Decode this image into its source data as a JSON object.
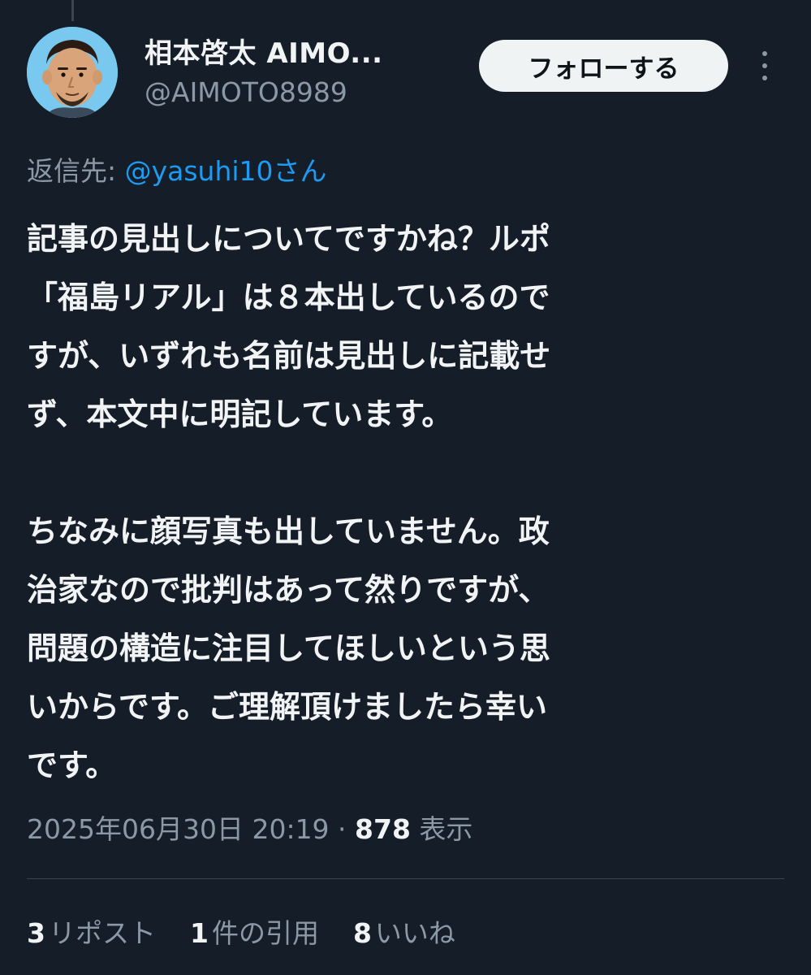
{
  "author": {
    "display_name": "相本啓太 AIMO...",
    "handle": "@AIMOTO8989"
  },
  "follow_label": "フォローする",
  "reply_to": {
    "prefix": "返信先: ",
    "mention": "@yasuhi10さん"
  },
  "tweet": {
    "paragraphs": [
      [
        "記事の見出しについてですかね？ルポ",
        "「福島リアル」は８本出しているので",
        "すが、いずれも名前は見出しに記載せ",
        "ず、本文中に明記しています。"
      ],
      [
        "ちなみに顔写真も出していません。政",
        "治家なので批判はあって然りですが、",
        "問題の構造に注目してほしいという思",
        "いからです。ご理解頂けましたら幸い",
        "です。"
      ]
    ]
  },
  "meta": {
    "timestamp": "2025年06月30日 20:19 · ",
    "views_count": "878",
    "views_label": " 表示"
  },
  "stats": {
    "reposts": {
      "count": "3",
      "label": "リポスト"
    },
    "quotes": {
      "count": "1",
      "label": "件の引用"
    },
    "likes": {
      "count": "8",
      "label": "いいね"
    }
  },
  "colors": {
    "background": "#151d28",
    "text_primary": "#f1f3f4",
    "text_secondary": "#8b98a5",
    "link": "#1d9bf0",
    "follow_button_bg": "#eff3f4",
    "avatar_bg": "#78c8ef"
  },
  "icons": {
    "more": "more-vertical-icon"
  }
}
